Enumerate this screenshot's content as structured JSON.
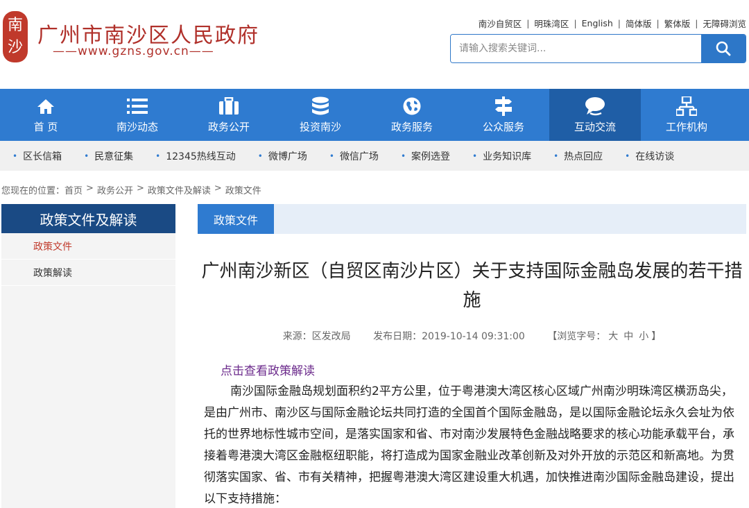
{
  "header": {
    "logo_text": "南沙",
    "site_title": "广州市南沙区人民政府",
    "site_url": "——www.gzns.gov.cn——",
    "top_links": [
      "南沙自贸区",
      "明珠湾区",
      "English",
      "简体版",
      "繁体版",
      "无障碍浏览"
    ],
    "search": {
      "placeholder": "请输入搜索关键词..."
    }
  },
  "main_nav": [
    {
      "label": "首 页",
      "icon": "home-icon"
    },
    {
      "label": "南沙动态",
      "icon": "list-icon"
    },
    {
      "label": "政务公开",
      "icon": "briefcase-icon"
    },
    {
      "label": "投资南沙",
      "icon": "database-icon"
    },
    {
      "label": "政务服务",
      "icon": "globe-icon"
    },
    {
      "label": "公众服务",
      "icon": "signpost-icon"
    },
    {
      "label": "互动交流",
      "icon": "chat-icon",
      "active": true
    },
    {
      "label": "工作机构",
      "icon": "org-chart-icon"
    }
  ],
  "sub_nav": [
    "区长信箱",
    "民意征集",
    "12345热线互动",
    "微博广场",
    "微信广场",
    "案例选登",
    "业务知识库",
    "热点回应",
    "在线访谈"
  ],
  "breadcrumb": {
    "prefix": "您现在的位置：",
    "items": [
      "首页",
      "政务公开",
      "政策文件及解读",
      "政策文件"
    ],
    "sep": ">"
  },
  "sidebar": {
    "title": "政策文件及解读",
    "items": [
      {
        "label": "政策文件",
        "active": true
      },
      {
        "label": "政策解读"
      }
    ]
  },
  "content": {
    "tab_label": "政策文件",
    "title": "广州南沙新区（自贸区南沙片区）关于支持国际金融岛发展的若干措施",
    "source": "来源：区发改局",
    "date": "发布日期：2019-10-14 09:31:00",
    "font_size_prefix": "【浏览字号：",
    "font_sizes": [
      "大",
      "中",
      "小"
    ],
    "font_size_suffix": "】",
    "policy_link": "点击查看政策解读",
    "paragraph": "南沙国际金融岛规划面积约2平方公里，位于粤港澳大湾区核心区域广州南沙明珠湾区横沥岛尖，是由广州市、南沙区与国际金融论坛共同打造的全国首个国际金融岛，是以国际金融论坛永久会址为依托的世界地标性城市空间，是落实国家和省、市对南沙发展特色金融战略要求的核心功能承载平台，承接着粤港澳大湾区金融枢纽职能，将打造成为国家金融业改革创新及对外开放的示范区和新高地。为贯彻落实国家、省、市有关精神，把握粤港澳大湾区建设重大机遇，加快推进南沙国际金融岛建设，提出以下支持措施："
  },
  "colors": {
    "brand_red": "#b0302a",
    "nav_blue": "#2f7bd0",
    "nav_active": "#1f5ea6",
    "sidebar_title_bg": "#1a4a84",
    "link_purple": "#6c2b8c"
  }
}
